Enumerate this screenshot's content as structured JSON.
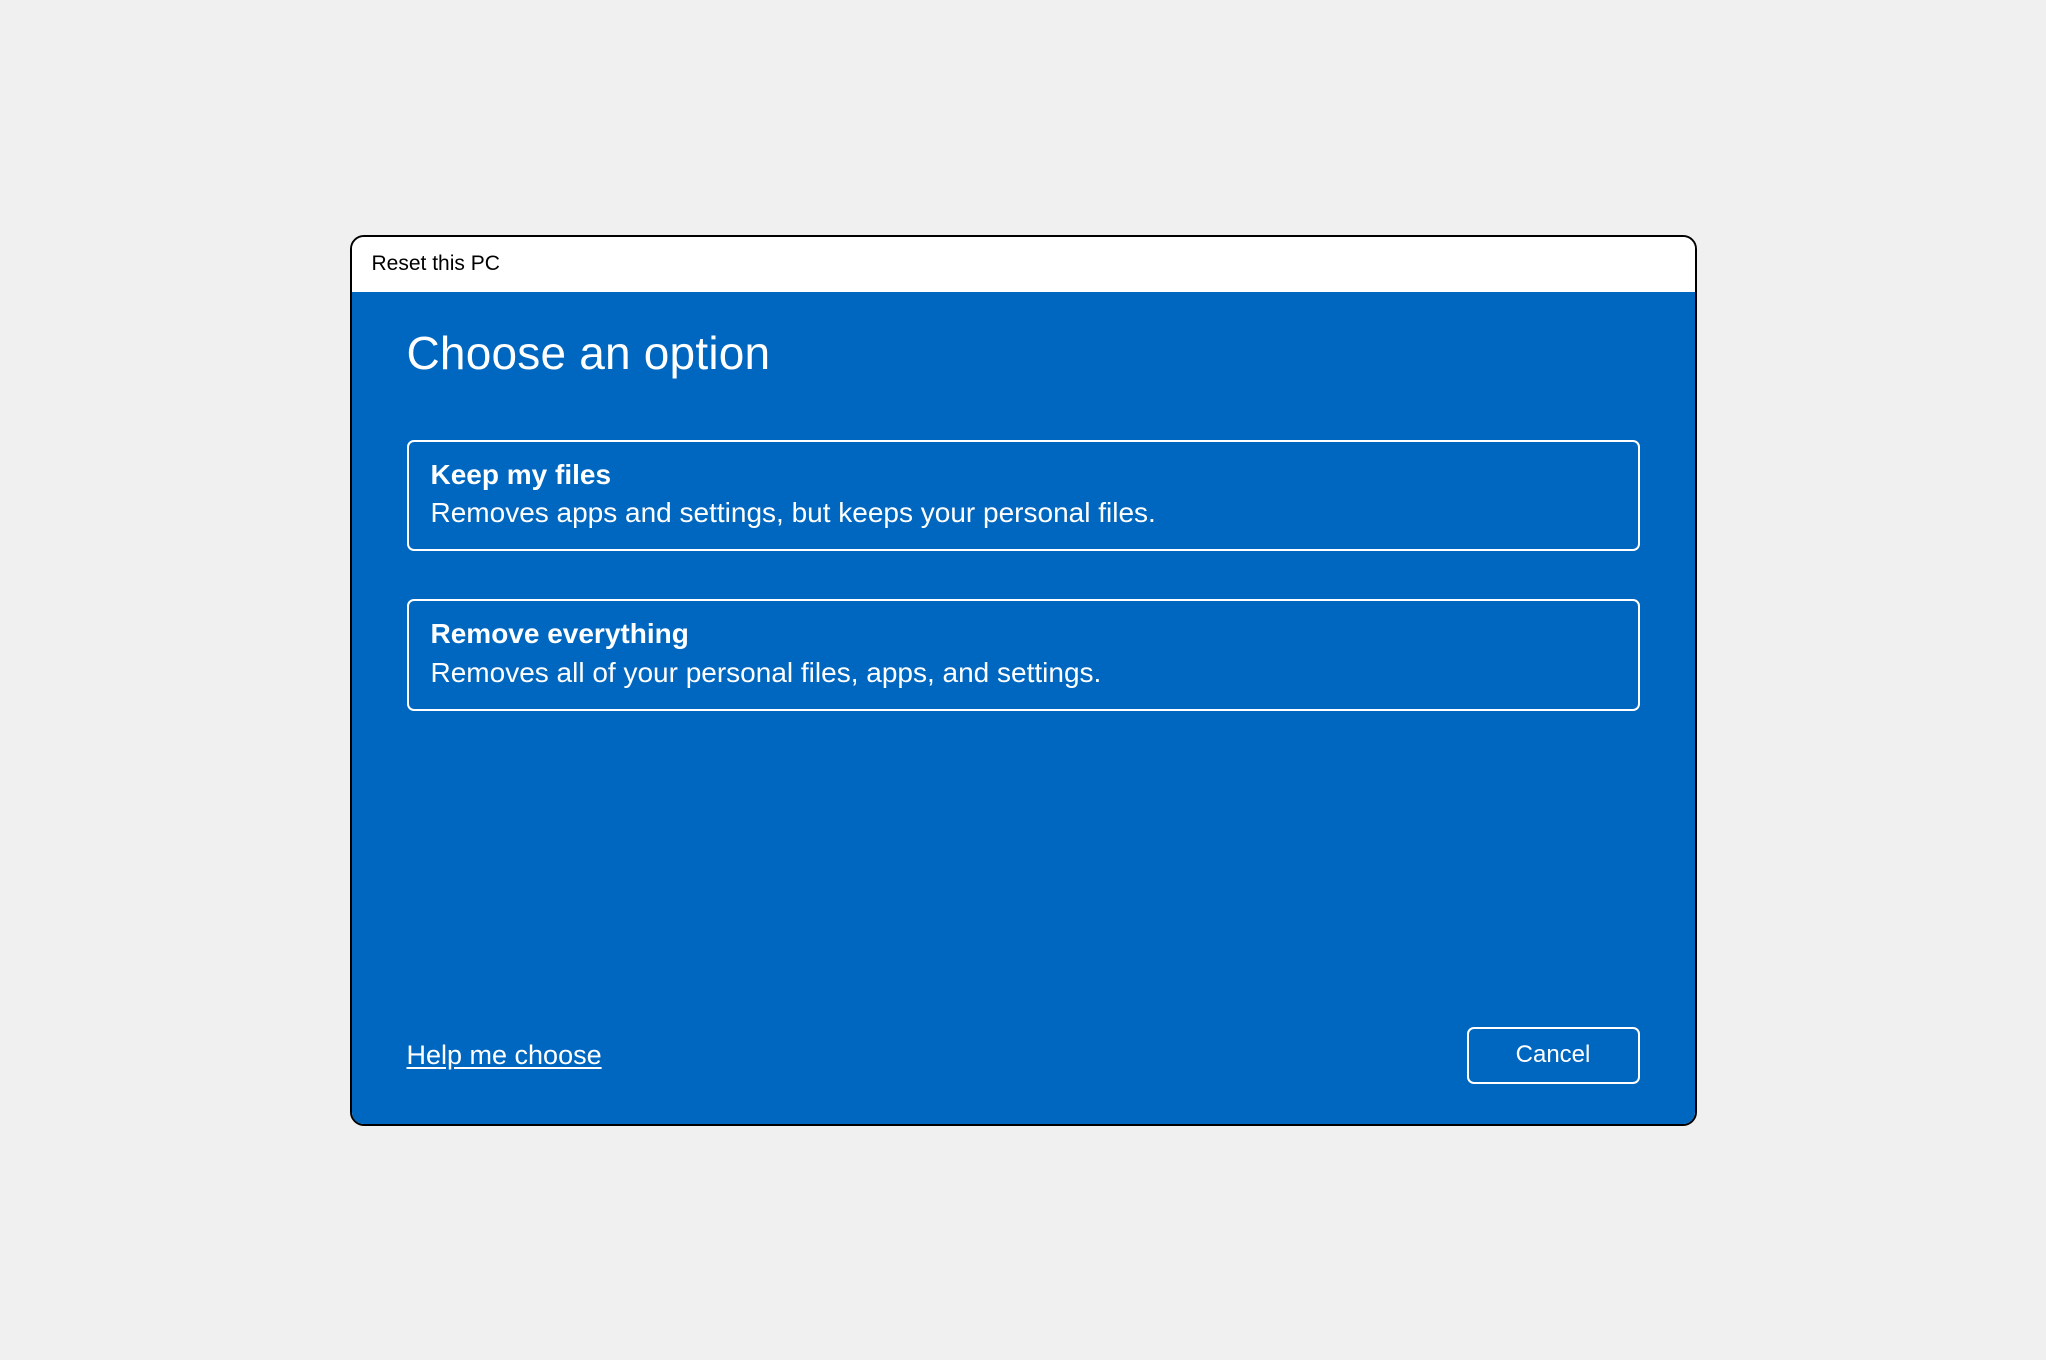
{
  "window": {
    "title": "Reset this PC"
  },
  "page": {
    "heading": "Choose an option"
  },
  "options": [
    {
      "title": "Keep my files",
      "description": "Removes apps and settings, but keeps your personal files."
    },
    {
      "title": "Remove everything",
      "description": "Removes all of your personal files, apps, and settings."
    }
  ],
  "footer": {
    "help_link": "Help me choose",
    "cancel_label": "Cancel"
  },
  "colors": {
    "primary_blue": "#0067C0"
  }
}
